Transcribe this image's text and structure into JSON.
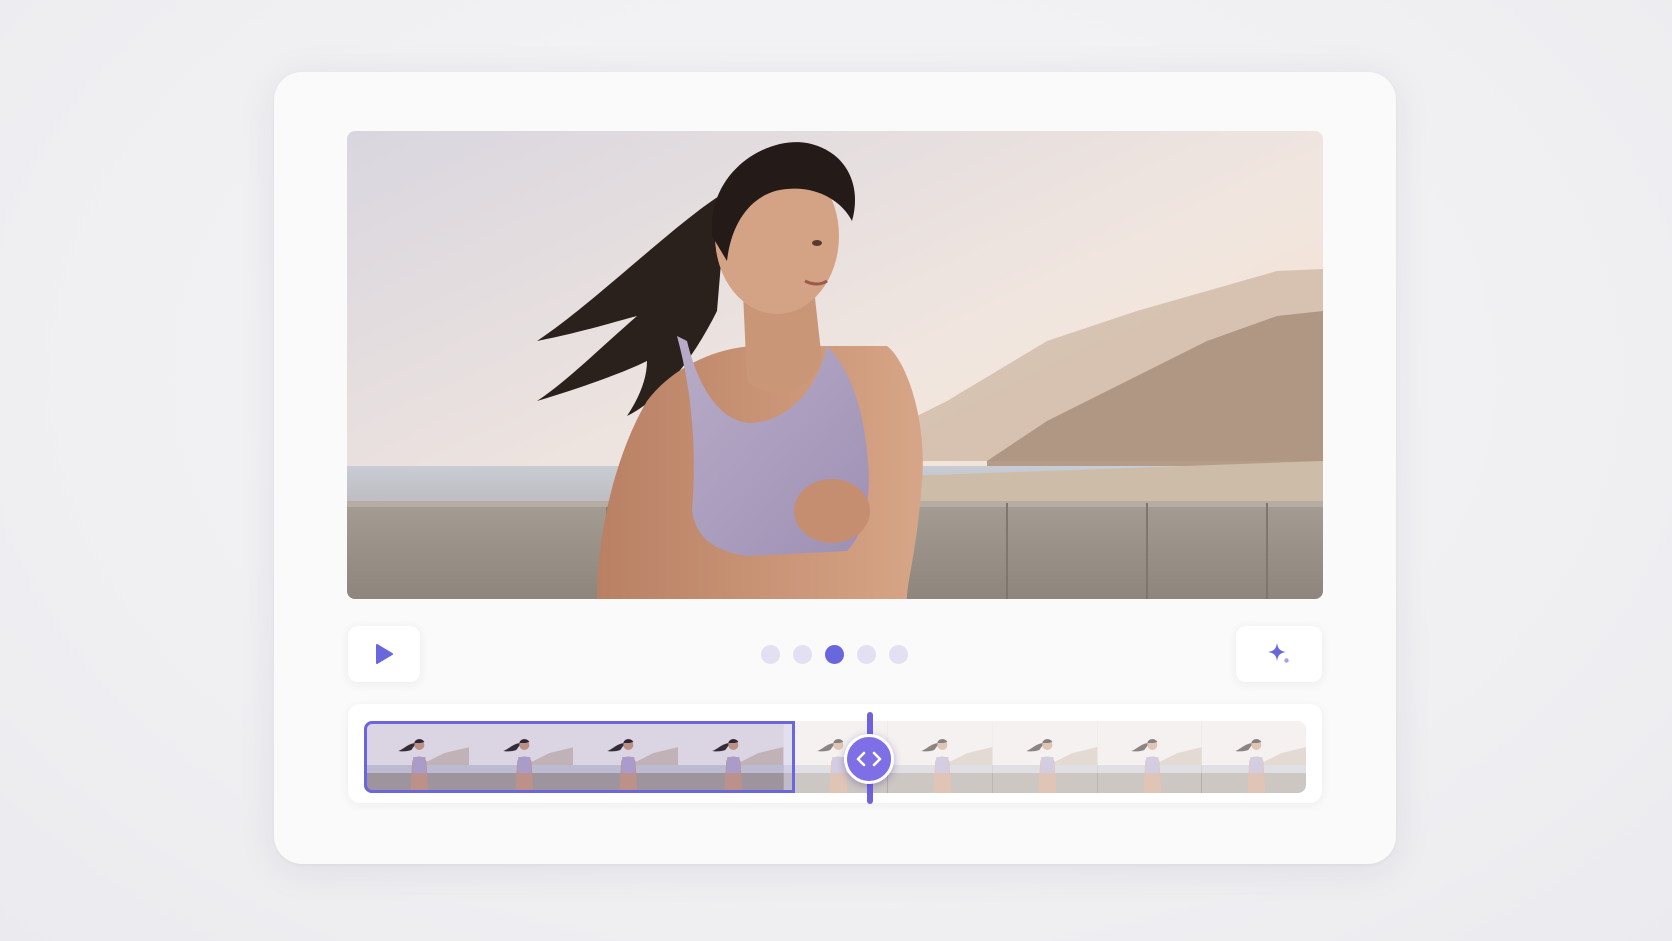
{
  "player": {
    "image": "runner-on-seaside-promenade",
    "icons": {
      "play": "play-icon",
      "magic": "sparkle-icon",
      "scrub": "code-arrows-icon"
    }
  },
  "pagination": {
    "count": 5,
    "active_index": 2
  },
  "timeline": {
    "frames": 9,
    "selected_fraction": 0.46,
    "playhead_fraction": 0.46
  },
  "colors": {
    "accent": "#6a66dd",
    "dot_inactive": "#e3e1f1",
    "scrubber": "#7e6fe6"
  }
}
